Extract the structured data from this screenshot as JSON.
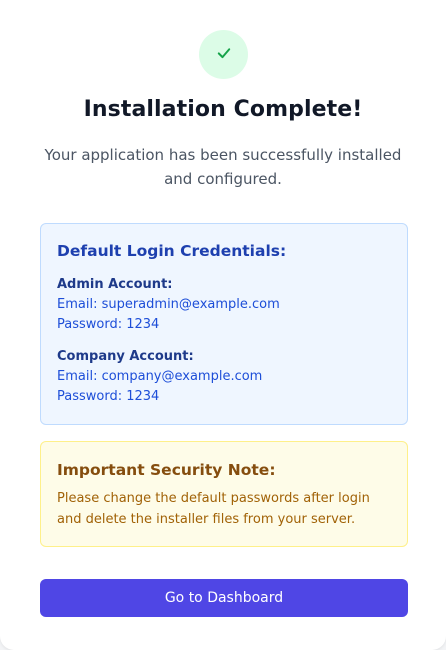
{
  "status": {
    "icon": "checkmark-icon",
    "title": "Installation Complete!",
    "subtitle": "Your application has been successfully installed and configured."
  },
  "credentials": {
    "heading": "Default Login Credentials:",
    "admin": {
      "label": "Admin Account:",
      "email": "Email: superadmin@example.com",
      "password": "Password: 1234"
    },
    "company": {
      "label": "Company Account:",
      "email": "Email: company@example.com",
      "password": "Password: 1234"
    }
  },
  "security": {
    "heading": "Important Security Note:",
    "message": "Please change the default passwords after login and delete the installer files from your server."
  },
  "actions": {
    "dashboard_label": "Go to Dashboard"
  },
  "colors": {
    "accent": "#4f46e5",
    "success_bg": "#dcfce7",
    "success_icon": "#16a34a",
    "info_bg": "#eff6ff",
    "info_text": "#1e40af",
    "warning_bg": "#fefce8",
    "warning_text": "#854d0e"
  }
}
